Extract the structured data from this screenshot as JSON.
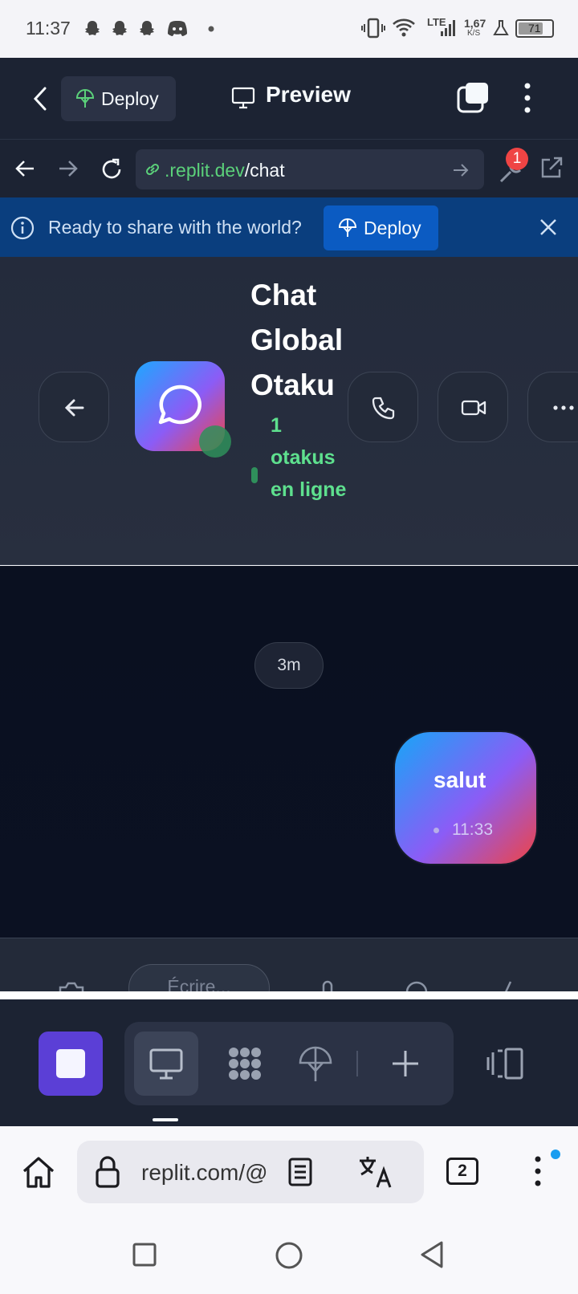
{
  "status_bar": {
    "time": "11:37",
    "network": "LTE",
    "speed_value": "1,67",
    "speed_unit": "K/S",
    "battery": "71"
  },
  "replit_header": {
    "deploy_label": "Deploy",
    "preview_label": "Preview"
  },
  "browser": {
    "url_domain": ".replit.dev",
    "url_path": "/chat",
    "devtools_badge": "1"
  },
  "banner": {
    "text": "Ready to share with the world?",
    "deploy_label": "Deploy"
  },
  "chat": {
    "title": "Chat Global Otaku",
    "online_status": "1 otakus en ligne",
    "time_separator": "3m",
    "messages": [
      {
        "text": "salut",
        "time": "11:33",
        "outgoing": true
      }
    ],
    "composer_placeholder": "Écrire..."
  },
  "chrome": {
    "omnibox_text": "replit.com/@",
    "tab_count": "2"
  },
  "colors": {
    "replit_bg": "#1c2333",
    "banner_bg": "#0a3e7e",
    "accent_green": "#5ee08e",
    "stop_purple": "#5b3fd6",
    "badge_red": "#ef4444"
  },
  "icons": {
    "status": [
      "snapchat-icon",
      "snapchat-icon",
      "snapchat-icon",
      "discord-icon",
      "vibrate-icon",
      "wifi-icon",
      "signal-icon",
      "lab-icon",
      "battery-icon"
    ],
    "header": [
      "back-chevron-icon",
      "deploy-icon",
      "monitor-icon",
      "tabs-icon",
      "more-vertical-icon"
    ],
    "urlbar": [
      "back-arrow-icon",
      "forward-arrow-icon",
      "reload-icon",
      "link-icon",
      "go-arrow-icon",
      "devtools-icon",
      "external-link-icon"
    ],
    "chat_header": [
      "arrow-left-icon",
      "chat-bubble-icon",
      "phone-icon",
      "video-icon",
      "more-horizontal-icon"
    ],
    "toolbar": [
      "stop-icon",
      "desktop-icon",
      "workspace-icon",
      "deploy-icon",
      "plus-icon",
      "panels-icon"
    ],
    "chrome": [
      "home-icon",
      "lock-icon",
      "reader-mode-icon",
      "translate-icon",
      "tab-switcher-icon",
      "menu-icon"
    ],
    "android_nav": [
      "recents-icon",
      "home-circle-icon",
      "back-triangle-icon"
    ]
  }
}
